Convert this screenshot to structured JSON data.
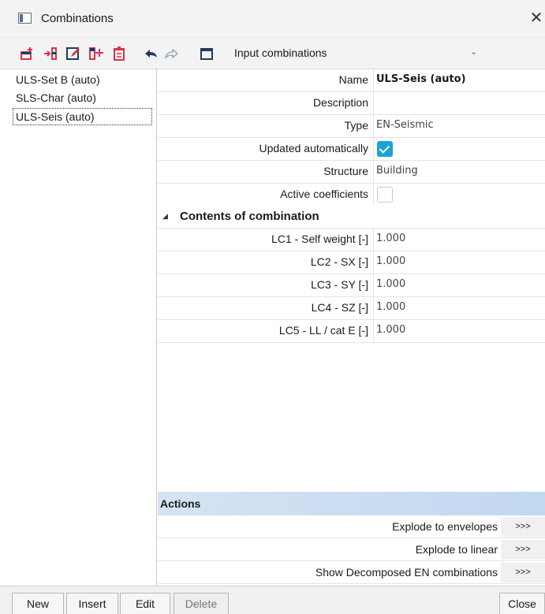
{
  "window": {
    "title": "Combinations",
    "close_glyph": "✕"
  },
  "toolbar": {
    "icons": [
      "new-icon",
      "insert-icon",
      "edit-icon",
      "copy-icon",
      "delete-icon",
      "undo-icon",
      "redo-icon",
      "table-icon"
    ],
    "combo_value": "Input combinations",
    "combo_arrow": "⌄"
  },
  "list": {
    "items": [
      "ULS-Set B (auto)",
      "SLS-Char (auto)",
      "ULS-Seis (auto)"
    ],
    "selected": "ULS-Seis (auto)"
  },
  "properties": {
    "name_label": "Name",
    "name_value": "ULS-Seis (auto)",
    "description_label": "Description",
    "description_value": "",
    "type_label": "Type",
    "type_value": "EN-Seismic",
    "updated_label": "Updated automatically",
    "updated_checked": true,
    "structure_label": "Structure",
    "structure_value": "Building",
    "active_coeff_label": "Active coefficients",
    "active_coeff_checked": false
  },
  "contents": {
    "title": "Contents of combination",
    "rows": [
      {
        "label": "LC1 - Self weight [-]",
        "value": "1.000"
      },
      {
        "label": "LC2 - SX [-]",
        "value": "1.000"
      },
      {
        "label": "LC3 - SY [-]",
        "value": "1.000"
      },
      {
        "label": "LC4 - SZ [-]",
        "value": "1.000"
      },
      {
        "label": "LC5 - LL / cat E [-]",
        "value": "1.000"
      }
    ]
  },
  "actions": {
    "title": "Actions",
    "items": [
      {
        "label": "Explode to envelopes",
        "button": ">>>"
      },
      {
        "label": "Explode to linear",
        "button": ">>>"
      },
      {
        "label": "Show Decomposed EN combinations",
        "button": ">>>"
      }
    ]
  },
  "buttons": {
    "new": "New",
    "insert": "Insert",
    "edit": "Edit",
    "delete": "Delete",
    "close": "Close"
  },
  "colors": {
    "accent": "#1aa3d9",
    "actions_header": "#c8dcf2",
    "toolbar_icon_red": "#d9334a",
    "toolbar_icon_dark": "#1f3a5f"
  }
}
